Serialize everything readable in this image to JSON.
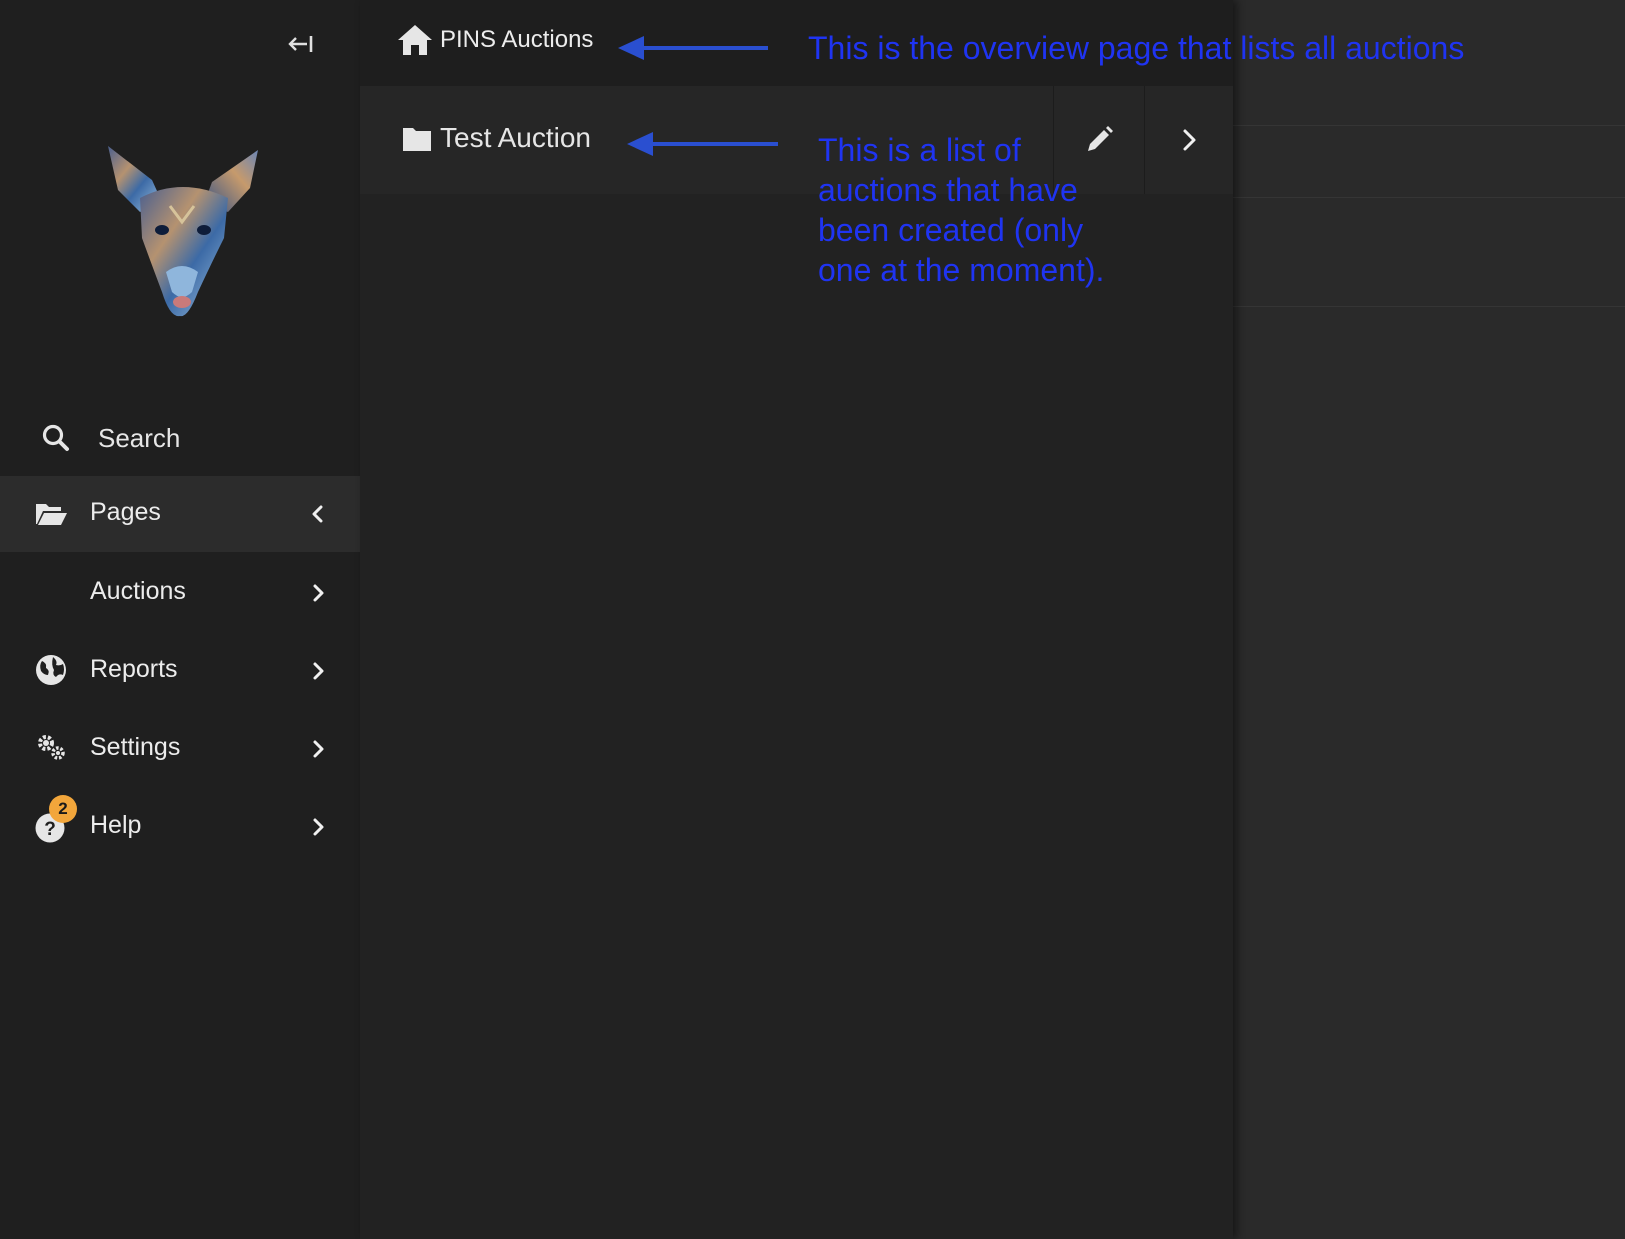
{
  "sidebar": {
    "collapse_label": "",
    "search_label": "Search",
    "items": [
      {
        "label": "Pages",
        "icon": "folder-open-icon"
      },
      {
        "label": "Auctions",
        "icon": ""
      },
      {
        "label": "Reports",
        "icon": "globe-icon"
      },
      {
        "label": "Settings",
        "icon": "gears-icon"
      },
      {
        "label": "Help",
        "icon": "question-icon",
        "badge": "2"
      }
    ]
  },
  "header": {
    "title": "PINS Auctions",
    "icon": "home-icon"
  },
  "auctions": [
    {
      "name": "Test Auction",
      "icon": "folder-icon"
    }
  ],
  "annotations": {
    "overview": "This is the overview page that lists all auctions",
    "list": "This is a list of\nauctions that have\nbeen created (only\none at the moment)."
  },
  "colors": {
    "sidebar_bg": "#1f1f1f",
    "panel_bg": "#222222",
    "annotation_text": "#1f34f2",
    "annotation_arrow": "#2a4fd0",
    "badge": "#f2a63b"
  }
}
